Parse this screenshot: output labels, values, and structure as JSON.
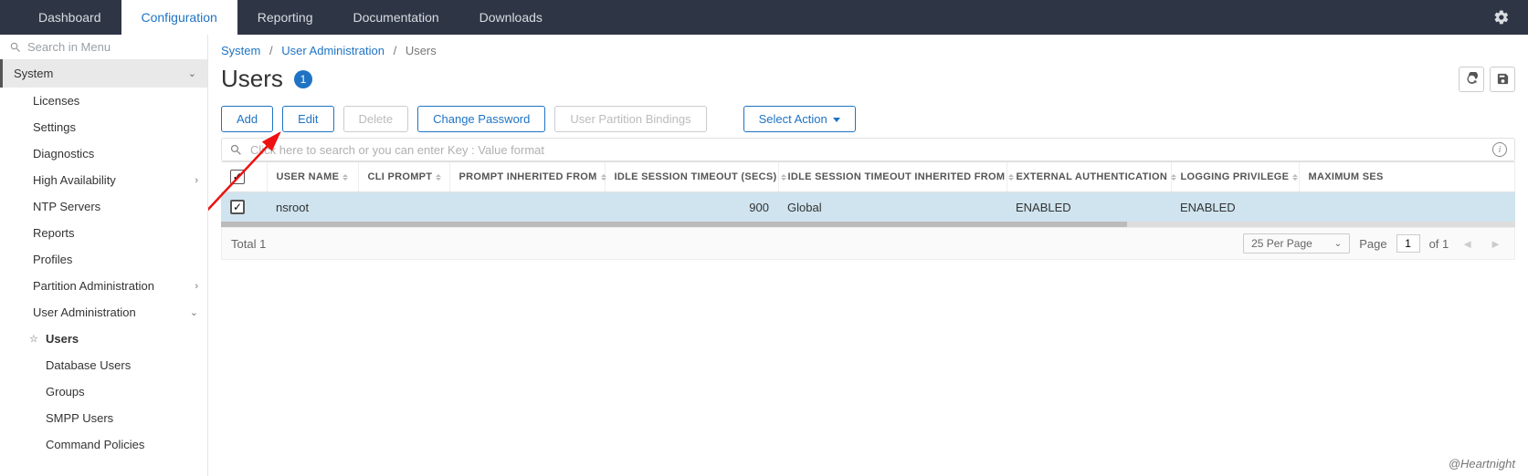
{
  "topnav": {
    "items": [
      "Dashboard",
      "Configuration",
      "Reporting",
      "Documentation",
      "Downloads"
    ],
    "active_index": 1
  },
  "sidebar": {
    "search_placeholder": "Search in Menu",
    "group_label": "System",
    "items": [
      {
        "label": "Licenses"
      },
      {
        "label": "Settings"
      },
      {
        "label": "Diagnostics"
      },
      {
        "label": "High Availability",
        "expandable": true
      },
      {
        "label": "NTP Servers"
      },
      {
        "label": "Reports"
      },
      {
        "label": "Profiles"
      },
      {
        "label": "Partition Administration",
        "expandable": true
      },
      {
        "label": "User Administration",
        "expandable": true,
        "expanded": true
      }
    ],
    "user_admin_children": [
      {
        "label": "Users",
        "active": true
      },
      {
        "label": "Database Users"
      },
      {
        "label": "Groups"
      },
      {
        "label": "SMPP Users"
      },
      {
        "label": "Command Policies"
      }
    ]
  },
  "breadcrumb": {
    "a": "System",
    "b": "User Administration",
    "c": "Users"
  },
  "page": {
    "title": "Users",
    "count": "1"
  },
  "toolbar": {
    "add": "Add",
    "edit": "Edit",
    "delete": "Delete",
    "change_pw": "Change Password",
    "bindings": "User Partition Bindings",
    "select_action": "Select Action"
  },
  "search": {
    "placeholder": "Click here to search or you can enter Key : Value format"
  },
  "table": {
    "columns": [
      "USER NAME",
      "CLI PROMPT",
      "PROMPT INHERITED FROM",
      "IDLE SESSION TIMEOUT (SECS)",
      "IDLE SESSION TIMEOUT INHERITED FROM",
      "EXTERNAL AUTHENTICATION",
      "LOGGING PRIVILEGE",
      "MAXIMUM SES"
    ],
    "rows": [
      {
        "selected": true,
        "user_name": "nsroot",
        "cli_prompt": "",
        "prompt_inherited": "",
        "idle_timeout": "900",
        "idle_inherited": "Global",
        "ext_auth": "ENABLED",
        "logging": "ENABLED",
        "max_ses": ""
      }
    ]
  },
  "footer": {
    "total_label": "Total",
    "total": "1",
    "per_page": "25 Per Page",
    "page_label": "Page",
    "page": "1",
    "of_label": "of 1"
  },
  "watermark": "@Heartnight"
}
